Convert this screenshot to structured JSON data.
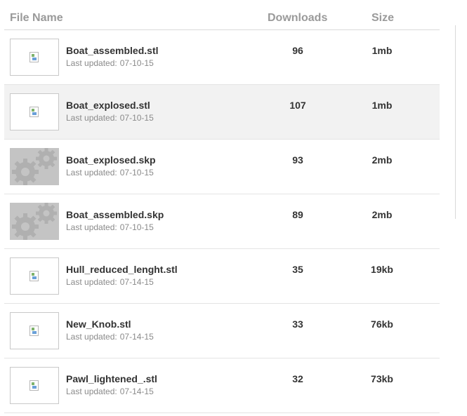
{
  "header": {
    "file_name": "File Name",
    "downloads": "Downloads",
    "size": "Size"
  },
  "updated_label": "Last updated:",
  "files": [
    {
      "name": "Boat_assembled.stl",
      "date": "07-10-15",
      "downloads": "96",
      "size": "1mb",
      "thumbnail": "broken-image-icon"
    },
    {
      "name": "Boat_explosed.stl",
      "date": "07-10-15",
      "downloads": "107",
      "size": "1mb",
      "thumbnail": "broken-image-icon"
    },
    {
      "name": "Boat_explosed.skp",
      "date": "07-10-15",
      "downloads": "93",
      "size": "2mb",
      "thumbnail": "gear-icon"
    },
    {
      "name": "Boat_assembled.skp",
      "date": "07-10-15",
      "downloads": "89",
      "size": "2mb",
      "thumbnail": "gear-icon"
    },
    {
      "name": "Hull_reduced_lenght.stl",
      "date": "07-14-15",
      "downloads": "35",
      "size": "19kb",
      "thumbnail": "broken-image-icon"
    },
    {
      "name": "New_Knob.stl",
      "date": "07-14-15",
      "downloads": "33",
      "size": "76kb",
      "thumbnail": "broken-image-icon"
    },
    {
      "name": "Pawl_lightened_.stl",
      "date": "07-14-15",
      "downloads": "32",
      "size": "73kb",
      "thumbnail": "broken-image-icon"
    }
  ],
  "colors": {
    "header_text": "#9a9a9a",
    "row_alt_bg": "#f2f2f2",
    "gear_bg": "#c4c4c4",
    "text": "#333333"
  }
}
